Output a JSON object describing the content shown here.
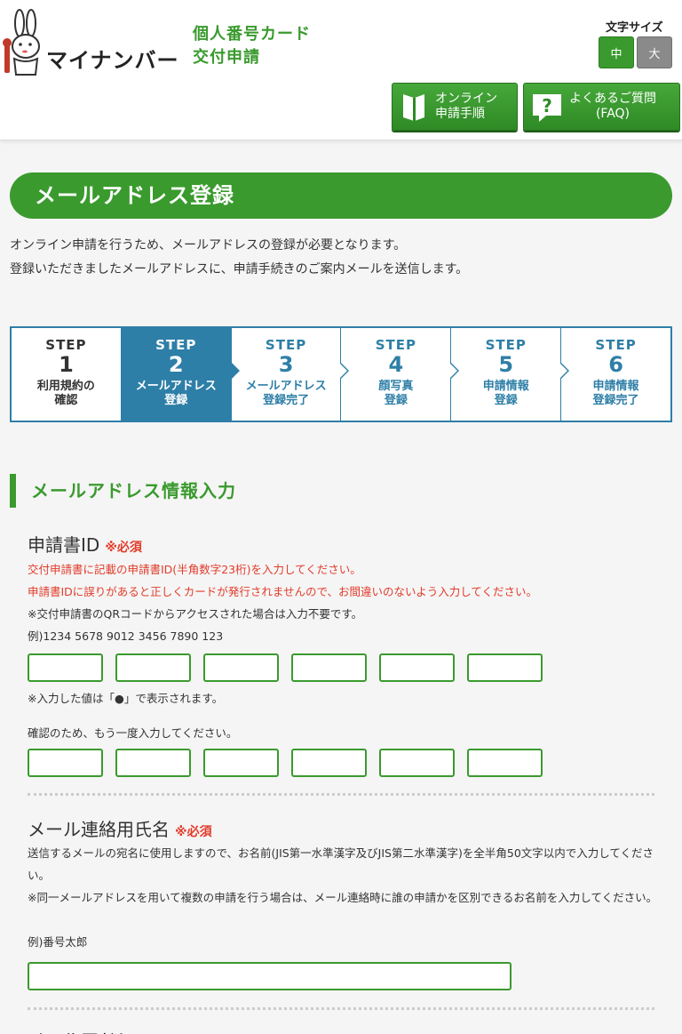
{
  "header": {
    "logo_text": "マイナンバー",
    "site_title_line1": "個人番号カード",
    "site_title_line2": "交付申請",
    "font_size_label": "文字サイズ",
    "font_size_mid": "中",
    "font_size_large": "大",
    "nav_online_line1": "オンライン",
    "nav_online_line2": "申請手順",
    "nav_faq_line1": "よくあるご質問",
    "nav_faq_line2": "(FAQ)"
  },
  "page": {
    "title": "メールアドレス登録",
    "intro_line1": "オンライン申請を行うため、メールアドレスの登録が必要となります。",
    "intro_line2": "登録いただきましたメールアドレスに、申請手続きのご案内メールを送信します。"
  },
  "steps": [
    {
      "label": "STEP",
      "num": "1",
      "name1": "利用規約の",
      "name2": "確認"
    },
    {
      "label": "STEP",
      "num": "2",
      "name1": "メールアドレス",
      "name2": "登録"
    },
    {
      "label": "STEP",
      "num": "3",
      "name1": "メールアドレス",
      "name2": "登録完了"
    },
    {
      "label": "STEP",
      "num": "4",
      "name1": "顔写真",
      "name2": "登録"
    },
    {
      "label": "STEP",
      "num": "5",
      "name1": "申請情報",
      "name2": "登録"
    },
    {
      "label": "STEP",
      "num": "6",
      "name1": "申請情報",
      "name2": "登録完了"
    }
  ],
  "section": {
    "title": "メールアドレス情報入力"
  },
  "application_id": {
    "label": "申請書ID",
    "required": "※必須",
    "note_red1": "交付申請書に記載の申請書ID(半角数字23桁)を入力してください。",
    "note_red2": "申請書IDに誤りがあると正しくカードが発行されませんので、お間違いのないよう入力してください。",
    "note_qr": "※交付申請書のQRコードからアクセスされた場合は入力不要です。",
    "example": "例)1234 5678 9012 3456 7890 123",
    "masked_note": "※入力した値は「●」で表示されます。",
    "confirm_note": "確認のため、もう一度入力してください。"
  },
  "mail_name": {
    "label": "メール連絡用氏名",
    "required": "※必須",
    "note1": "送信するメールの宛名に使用しますので、お名前(JIS第一水準漢字及びJIS第二水準漢字)を全半角50文字以内で入力してください。",
    "note2": "※同一メールアドレスを用いて複数の申請を行う場合は、メール連絡時に誰の申請かを区別できるお名前を入力してください。",
    "example": "例)番号太郎"
  },
  "next_heading": "メールアドレス"
}
